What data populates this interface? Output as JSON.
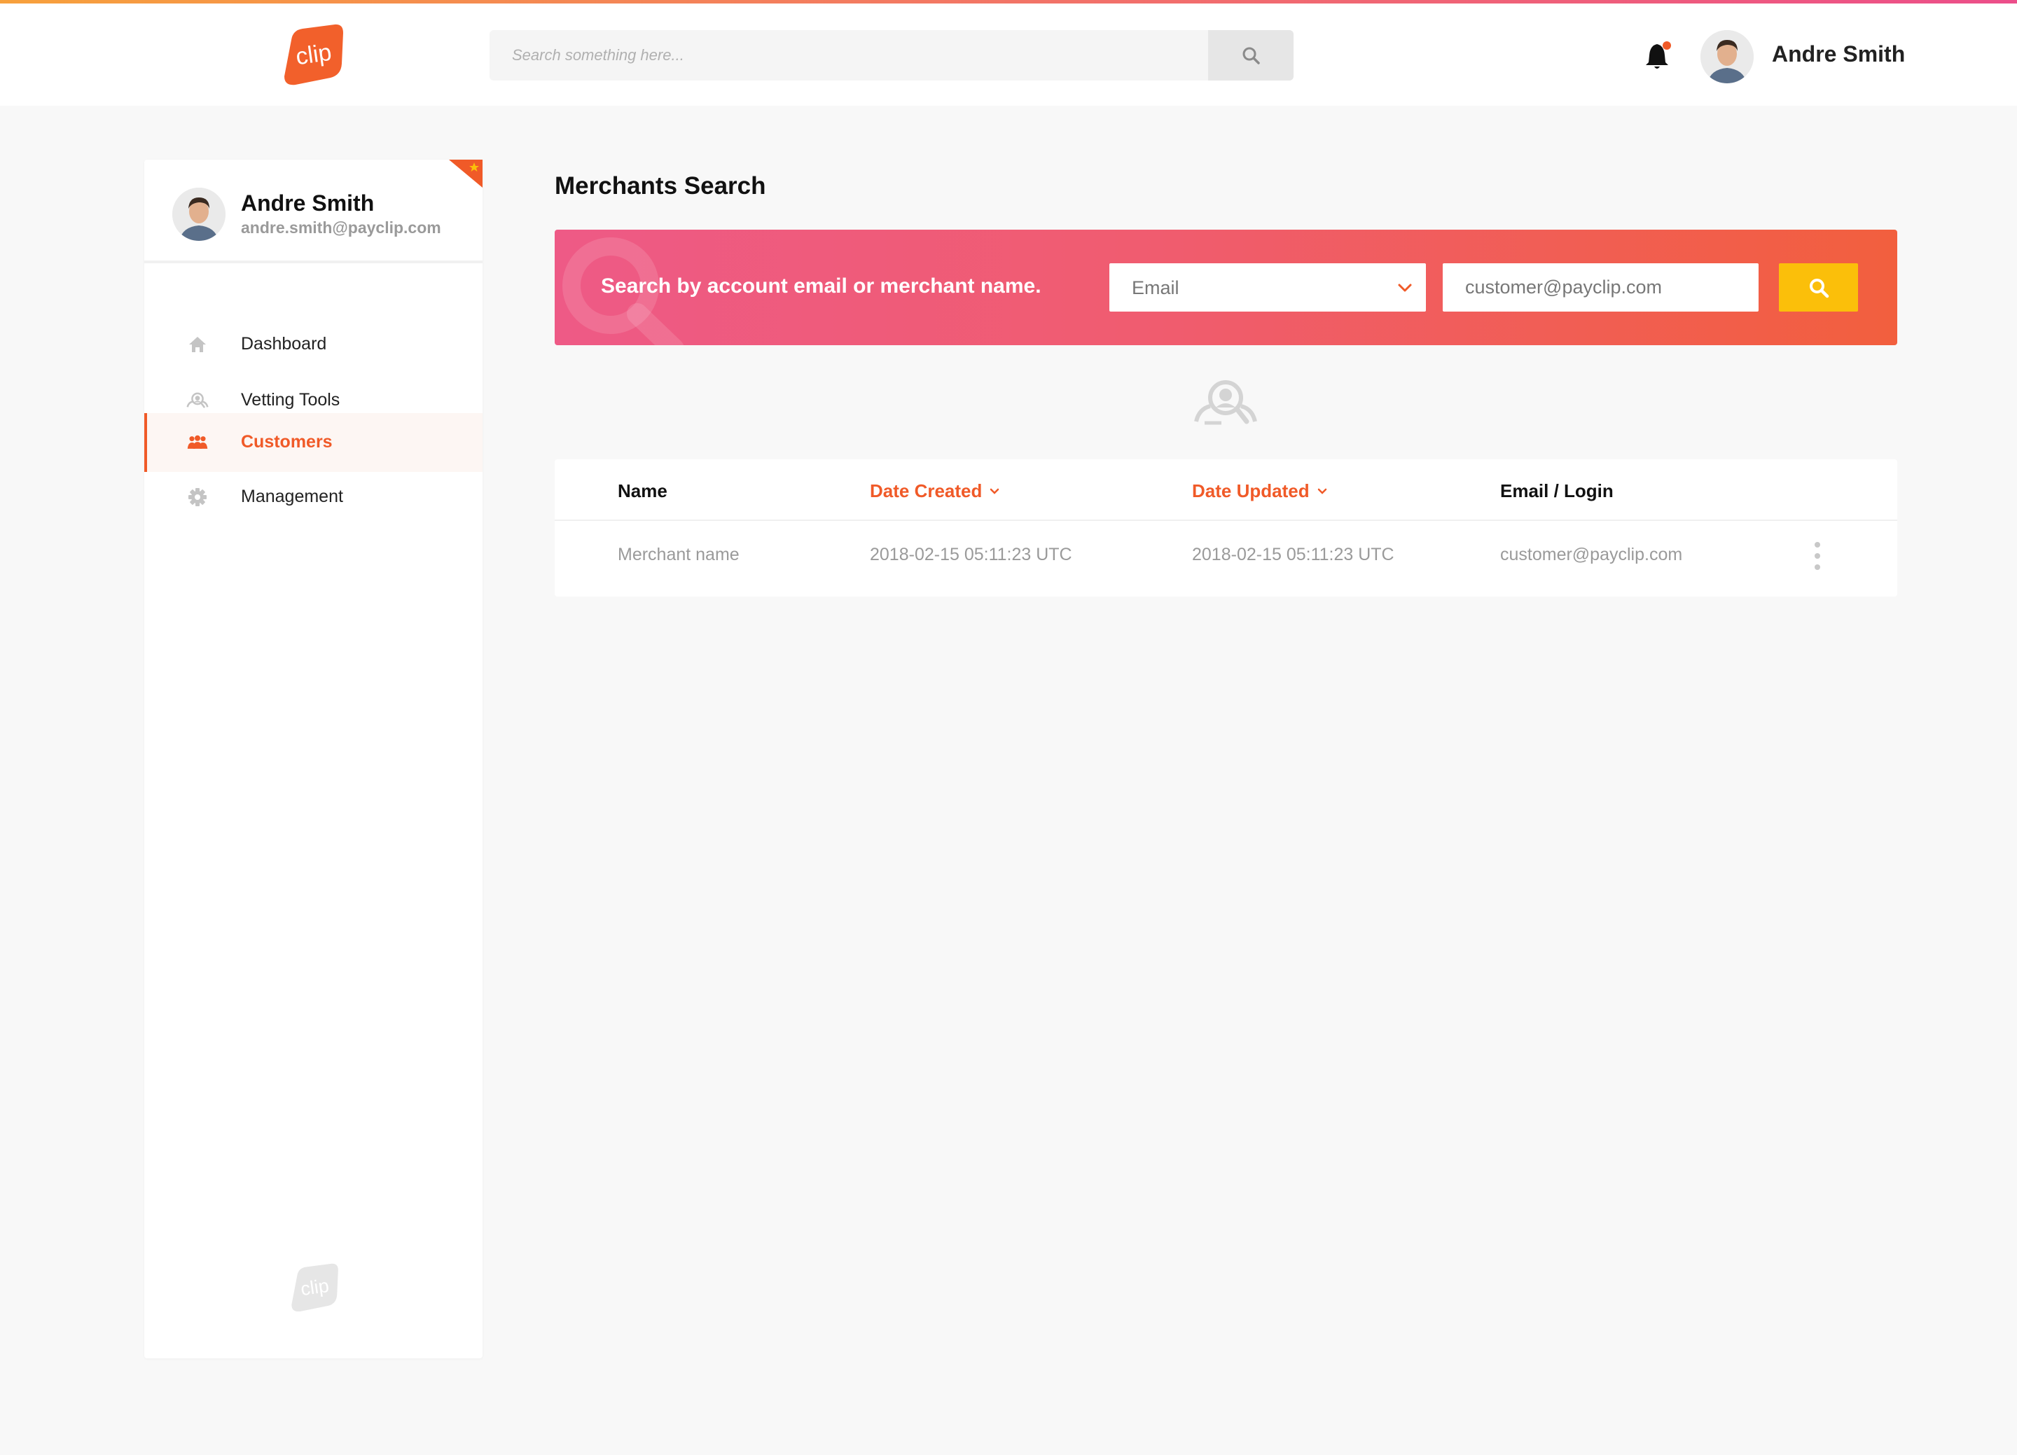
{
  "header": {
    "logo_text": "clip",
    "search_placeholder": "Search something here...",
    "user_name": "Andre Smith",
    "notification_dot_color": "#f05a28"
  },
  "sidebar": {
    "user_name": "Andre Smith",
    "user_email": "andre.smith@payclip.com",
    "items": [
      {
        "label": "Dashboard",
        "icon": "home-icon",
        "active": false
      },
      {
        "label": "Vetting Tools",
        "icon": "user-search-icon",
        "active": false
      },
      {
        "label": "Customers",
        "icon": "users-icon",
        "active": true
      },
      {
        "label": "Management",
        "icon": "gear-icon",
        "active": false
      }
    ],
    "footer_logo_text": "clip"
  },
  "main": {
    "title": "Merchants Search",
    "banner": {
      "text": "Search by account email or merchant name.",
      "select_value": "Email",
      "select_options": [
        "Email"
      ],
      "input_value": "customer@payclip.com"
    },
    "table": {
      "columns": [
        {
          "label": "Name",
          "sortable": false
        },
        {
          "label": "Date Created",
          "sortable": true
        },
        {
          "label": "Date Updated",
          "sortable": true
        },
        {
          "label": "Email / Login",
          "sortable": false
        }
      ],
      "rows": [
        {
          "name": "Merchant name",
          "date_created": "2018-02-15 05:11:23 UTC",
          "date_updated": "2018-02-15 05:11:23 UTC",
          "email": "customer@payclip.com"
        }
      ]
    }
  },
  "colors": {
    "accent": "#f05a28",
    "search_button": "#fbbf0a",
    "banner_gradient_start": "#ee5a86",
    "banner_gradient_end": "#f25f3e"
  }
}
